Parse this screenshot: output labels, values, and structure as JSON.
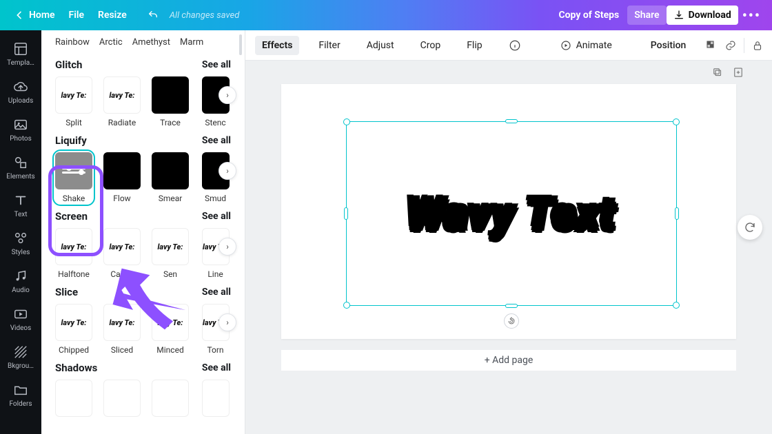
{
  "topbar": {
    "home": "Home",
    "file": "File",
    "resize": "Resize",
    "saved": "All changes saved",
    "doc_title": "Copy of Steps",
    "share": "Share",
    "download": "Download"
  },
  "nav": [
    {
      "label": "Templa…"
    },
    {
      "label": "Uploads"
    },
    {
      "label": "Photos"
    },
    {
      "label": "Elements"
    },
    {
      "label": "Text"
    },
    {
      "label": "Styles"
    },
    {
      "label": "Audio"
    },
    {
      "label": "Videos"
    },
    {
      "label": "Bkgrou…"
    },
    {
      "label": "Folders"
    }
  ],
  "panel": {
    "categories": [
      "Rainbow",
      "Arctic",
      "Amethyst",
      "Marm"
    ],
    "see_all": "See all",
    "sections": {
      "glitch": {
        "title": "Glitch",
        "items": [
          "Split",
          "Radiate",
          "Trace",
          "Stenc"
        ]
      },
      "liquify": {
        "title": "Liquify",
        "items": [
          "Shake",
          "Flow",
          "Smear",
          "Smud"
        ]
      },
      "screen": {
        "title": "Screen",
        "items": [
          "Halftone",
          "Calico",
          "Sen",
          "Line"
        ]
      },
      "slice": {
        "title": "Slice",
        "items": [
          "Chipped",
          "Sliced",
          "Minced",
          "Torn"
        ]
      },
      "shadows": {
        "title": "Shadows"
      }
    },
    "preview_text": "lavy Te:"
  },
  "toolbar": {
    "effects": "Effects",
    "filter": "Filter",
    "adjust": "Adjust",
    "crop": "Crop",
    "flip": "Flip",
    "animate": "Animate",
    "position": "Position"
  },
  "canvas": {
    "text": "Wavy Text",
    "add_page": "+ Add page"
  }
}
